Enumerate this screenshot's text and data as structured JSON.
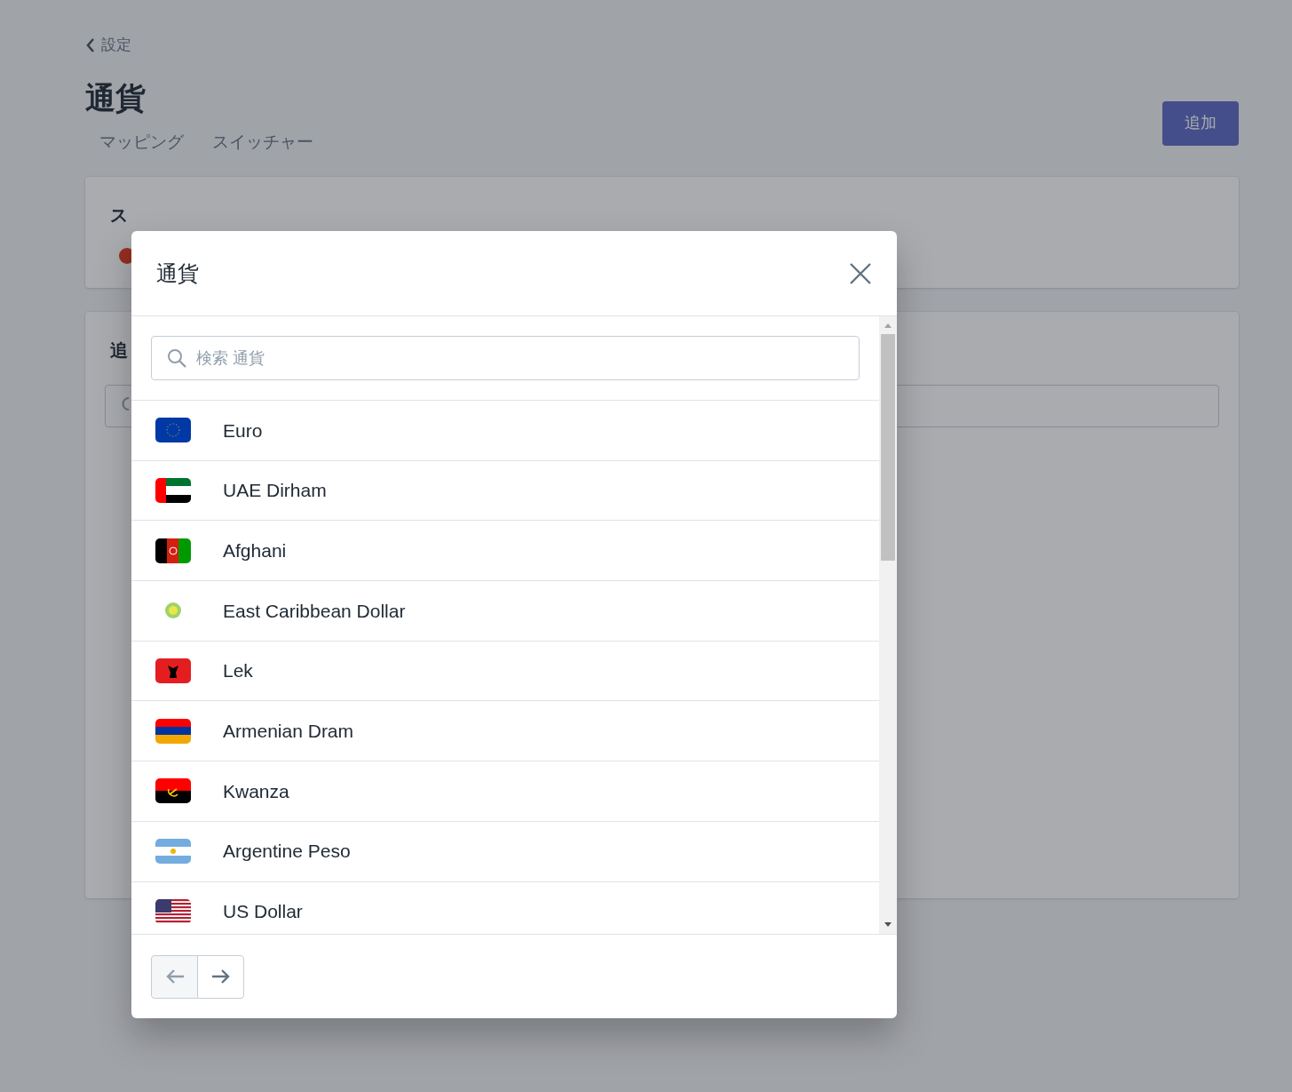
{
  "page": {
    "back_link": "設定",
    "title": "通貨",
    "tabs": [
      {
        "label": "マッピング"
      },
      {
        "label": "スイッチャー"
      }
    ],
    "add_button": "追加"
  },
  "store_card": {
    "title": "ス"
  },
  "add_card": {
    "title": "追"
  },
  "modal": {
    "title": "通貨",
    "search": {
      "placeholder": "検索 通貨"
    },
    "currencies": [
      {
        "name": "Euro"
      },
      {
        "name": "UAE Dirham"
      },
      {
        "name": "Afghani"
      },
      {
        "name": "East Caribbean Dollar"
      },
      {
        "name": "Lek"
      },
      {
        "name": "Armenian Dram"
      },
      {
        "name": "Kwanza"
      },
      {
        "name": "Argentine Peso"
      },
      {
        "name": "US Dollar"
      }
    ],
    "pager": [
      {
        "kind": "prev",
        "disabled": true
      },
      {
        "kind": "next",
        "disabled": false
      }
    ]
  }
}
